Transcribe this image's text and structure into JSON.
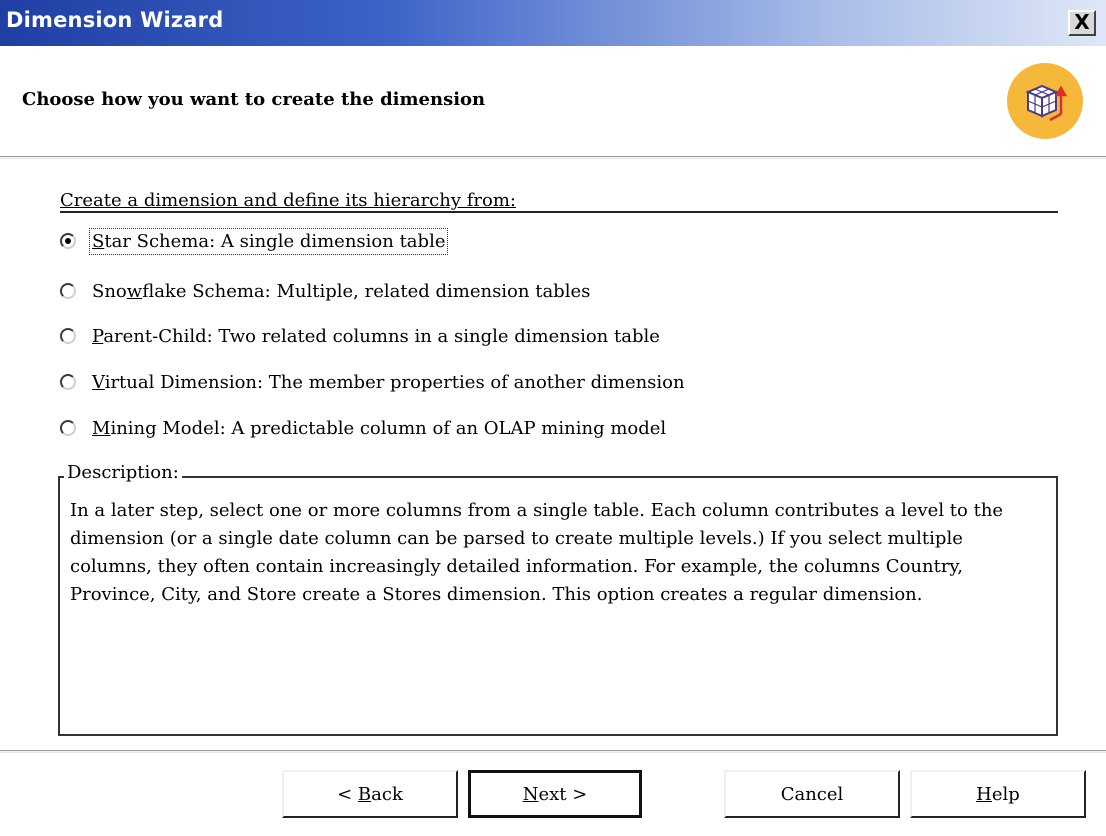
{
  "window": {
    "title": "Dimension Wizard",
    "close_label": "X"
  },
  "header": {
    "title": "Choose how you want to create the dimension",
    "icon": "dimension-cube-icon"
  },
  "options_group": {
    "label": "Create a dimension and define its hierarchy from:",
    "selected_index": 0,
    "options": [
      {
        "pre": "",
        "key": "S",
        "post": "tar Schema: A single dimension table"
      },
      {
        "pre": "Sno",
        "key": "w",
        "post": "flake Schema: Multiple, related dimension tables"
      },
      {
        "pre": "",
        "key": "P",
        "post": "arent-Child: Two related columns in a single dimension table"
      },
      {
        "pre": "",
        "key": "V",
        "post": "irtual Dimension: The member properties of another dimension"
      },
      {
        "pre": "",
        "key": "M",
        "post": "ining Model: A predictable column of an OLAP mining model"
      }
    ]
  },
  "description": {
    "legend": "Description:",
    "text": "In a later step, select one or more columns from a single table. Each column contributes a level to the dimension (or a single date column can be parsed to create multiple levels.) If you select multiple columns, they often contain increasingly detailed information. For example, the columns Country, Province, City, and Store create a Stores dimension. This option creates a regular dimension."
  },
  "buttons": {
    "back": {
      "pre": "< ",
      "key": "B",
      "post": "ack"
    },
    "next": {
      "pre": "",
      "key": "N",
      "post": "ext >"
    },
    "cancel": {
      "label": "Cancel"
    },
    "help": {
      "pre": "",
      "key": "H",
      "post": "elp"
    }
  },
  "colors": {
    "titlebar_start": "#1f3fa3",
    "titlebar_end": "#dfe7f7",
    "icon_circle": "#f5b83a"
  }
}
